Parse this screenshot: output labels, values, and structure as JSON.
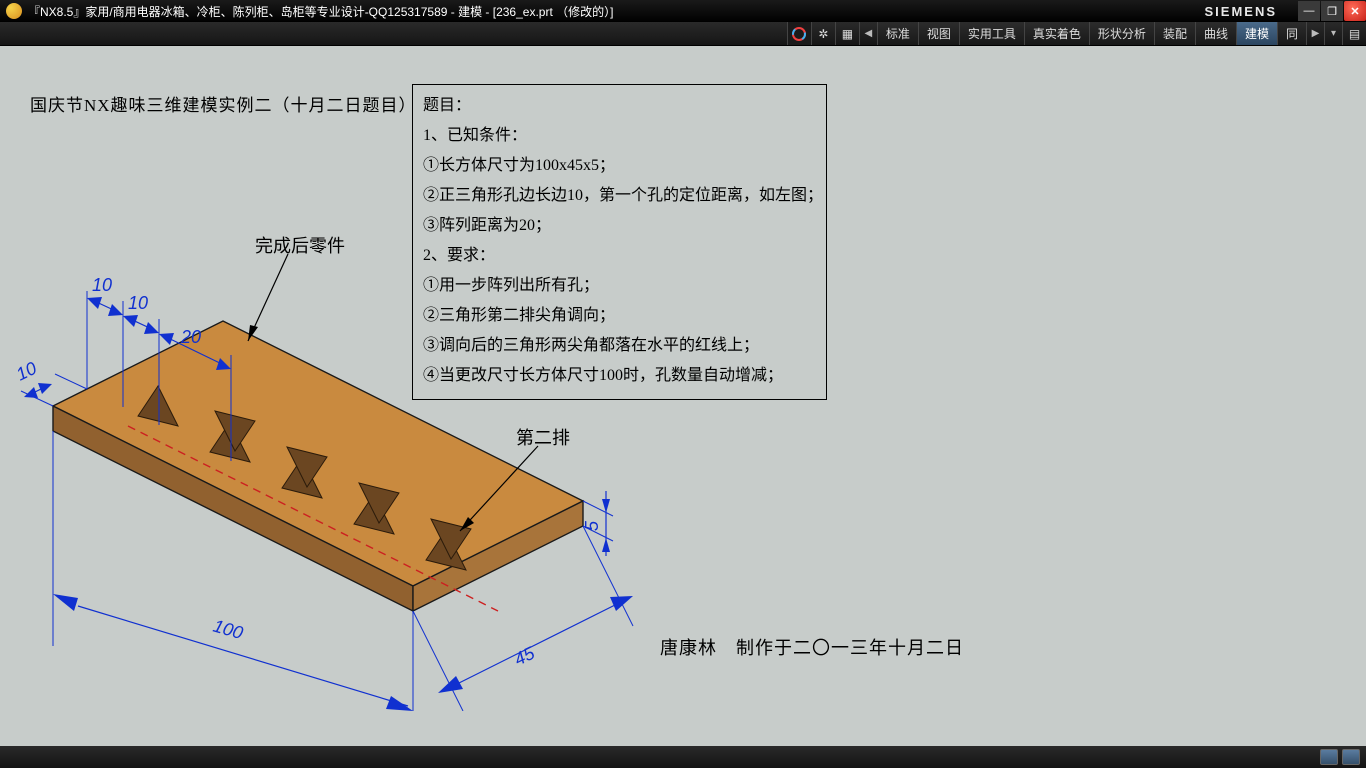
{
  "titlebar": {
    "title": "『NX8.5』家用/商用电器冰箱、冷柜、陈列柜、岛柜等专业设计-QQ125317589 - 建模 - [236_ex.prt （修改的）]",
    "brand": "SIEMENS"
  },
  "toolbar": {
    "tabs": [
      "标准",
      "视图",
      "实用工具",
      "真实着色",
      "形状分析",
      "装配",
      "曲线",
      "建模",
      "同"
    ],
    "active_index": 7
  },
  "drawing": {
    "title_text": "国庆节NX趣味三维建模实例二（十月二日题目）",
    "finished_label": "完成后零件",
    "second_row_label": "第二排",
    "dims": {
      "d10a": "10",
      "d10b": "10",
      "d10c": "10",
      "d20": "20",
      "d100": "100",
      "d45": "45",
      "d5": "5"
    },
    "problem": {
      "l0": "题目：",
      "l1": "1、已知条件：",
      "l2": "①长方体尺寸为100x45x5；",
      "l3": "②正三角形孔边长边10，第一个孔的定位距离，如左图；",
      "l4": "③阵列距离为20；",
      "l5": "2、要求：",
      "l6": "①用一步阵列出所有孔；",
      "l7": "②三角形第二排尖角调向；",
      "l8": "③调向后的三角形两尖角都落在水平的红线上；",
      "l9": "④当更改尺寸长方体尺寸100时，孔数量自动增减；"
    },
    "credit": "唐康林　制作于二〇一三年十月二日"
  }
}
